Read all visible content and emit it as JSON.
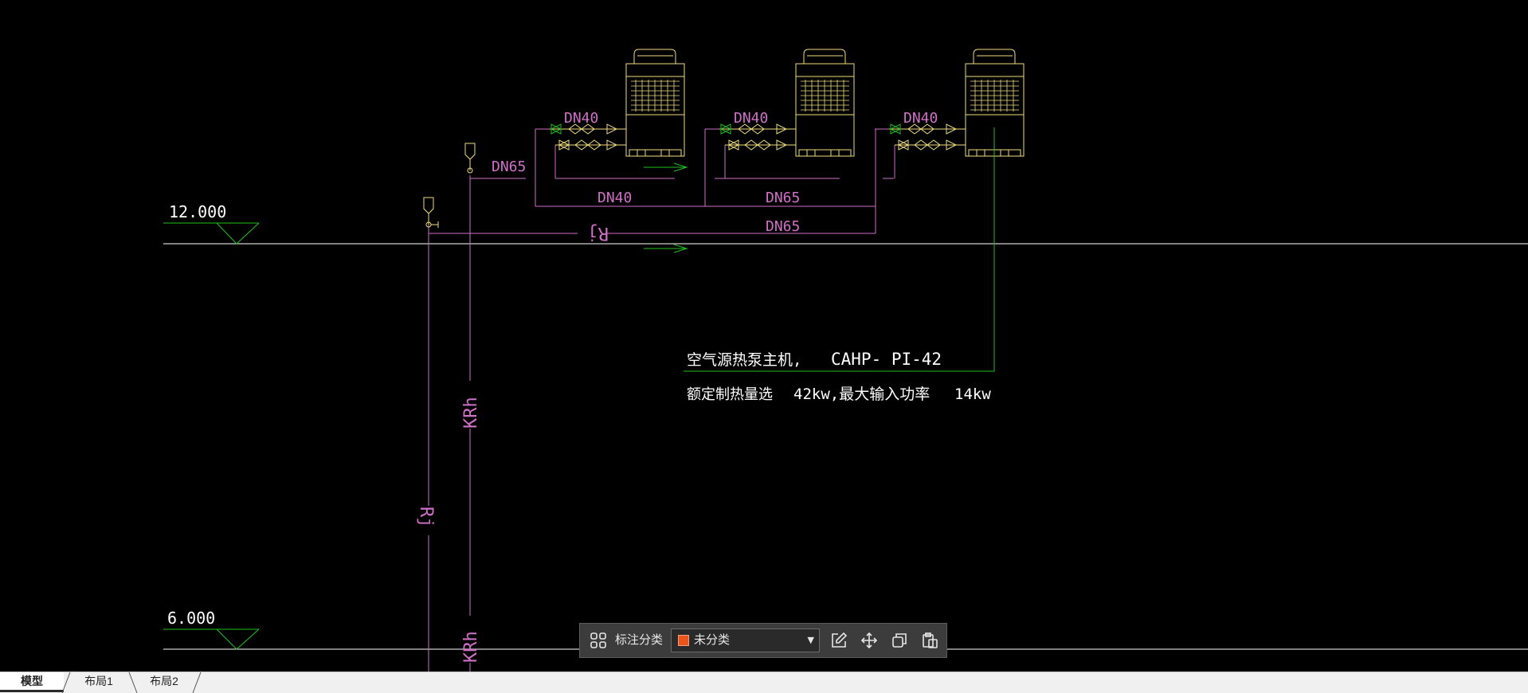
{
  "drawing": {
    "elevation_upper": "12.000",
    "elevation_lower": "6.000",
    "dn_upper": [
      "DN40",
      "DN40",
      "DN40"
    ],
    "dn_feed": "DN65",
    "dn_header_top": [
      "DN40",
      "DN65"
    ],
    "dn_header_bottom": "DN65",
    "rj_label": "Rj",
    "krh_label": "KRh",
    "spec_title": "空气源热泵主机,",
    "spec_model": "CAHP- PI-42",
    "spec_capacity_label": "额定制热量选",
    "spec_capacity_value": "42kw,最大输入功率",
    "spec_power_value": "14kw"
  },
  "toolbar": {
    "label": "标注分类",
    "select_value": "未分类",
    "icons": [
      "grid-icon",
      "edit-icon",
      "move-icon",
      "copy-icon",
      "paste-icon"
    ]
  },
  "tabs": {
    "model": "模型",
    "layout1": "布局1",
    "layout2": "布局2"
  },
  "colors": {
    "background": "#000000",
    "pipe_magenta": "#d070c8",
    "equipment_yellow": "#f0dc80",
    "leader_green": "#20c020",
    "text_white": "#ffffff",
    "swatch": "#e8561e"
  }
}
